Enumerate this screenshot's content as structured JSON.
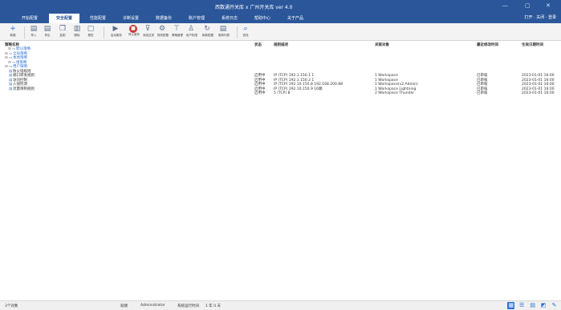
{
  "window": {
    "title": "西数通开关库 x 广州开关库 ver 4.0",
    "controls": [
      "—",
      "▢",
      "✕"
    ]
  },
  "tabs": [
    {
      "label": "开始配置",
      "active": false
    },
    {
      "label": "安全配置",
      "active": true
    },
    {
      "label": "性能配置",
      "active": false
    },
    {
      "label": "诊断设置",
      "active": false
    },
    {
      "label": "数据备份",
      "active": false
    },
    {
      "label": "账户管理",
      "active": false
    },
    {
      "label": "系统日志",
      "active": false
    },
    {
      "label": "帮助中心",
      "active": false
    },
    {
      "label": "关于产品",
      "active": false
    }
  ],
  "tabs_right": "打开 · 关闭 · 登录",
  "toolbar": [
    {
      "label": "新建",
      "icon": "plus-icon",
      "glyph": "+",
      "style": "blue"
    },
    {
      "label": "导入",
      "icon": "import-icon",
      "glyph": "▤",
      "style": ""
    },
    {
      "label": "导出",
      "icon": "export-icon",
      "glyph": "▤",
      "style": ""
    },
    {
      "label": "复制",
      "icon": "copy-icon",
      "glyph": "❐",
      "style": ""
    },
    {
      "label": "删除",
      "icon": "delete-icon",
      "glyph": "▥",
      "style": ""
    },
    {
      "label": "属性",
      "icon": "properties-icon",
      "glyph": "▢",
      "style": ""
    },
    {
      "label": "启动服务",
      "icon": "play-icon",
      "glyph": "▶",
      "style": ""
    },
    {
      "label": "停止服务",
      "icon": "stop-icon",
      "glyph": "■",
      "style": "red"
    },
    {
      "label": "添加过滤",
      "icon": "filter-icon",
      "glyph": "⊽",
      "style": ""
    },
    {
      "label": "规则配置",
      "icon": "rule-icon",
      "glyph": "⚙",
      "style": ""
    },
    {
      "label": "策略管理",
      "icon": "policy-icon",
      "glyph": "⊤",
      "style": ""
    },
    {
      "label": "用户权限",
      "icon": "user-icon",
      "glyph": "♙",
      "style": ""
    },
    {
      "label": "刷新配置",
      "icon": "refresh-icon",
      "glyph": "↻",
      "style": ""
    },
    {
      "label": "更新列表",
      "icon": "list-icon",
      "glyph": "▤",
      "style": ""
    },
    {
      "label": "查找",
      "icon": "search-icon",
      "glyph": "⌕",
      "style": "blue"
    }
  ],
  "tree": {
    "header": "策略名称",
    "nodes": [
      {
        "label": "默认策略",
        "depth": 1,
        "blue": true,
        "icon": "folder-icon"
      },
      {
        "label": "全局策略",
        "depth": 0,
        "blue": true,
        "icon": "folder-icon"
      },
      {
        "label": "本地策略",
        "depth": 0,
        "blue": true,
        "icon": "folder-icon"
      },
      {
        "label": "组策略",
        "depth": 1,
        "blue": true,
        "icon": "folder-icon"
      },
      {
        "label": "用户策略",
        "depth": 0,
        "blue": true,
        "icon": "folder-icon"
      },
      {
        "label": "防火墙规则",
        "depth": 0,
        "blue": false,
        "icon": "document-icon"
      },
      {
        "label": "端口转发规则",
        "depth": 0,
        "blue": false,
        "icon": "document-icon"
      },
      {
        "label": "访问控制",
        "depth": 0,
        "blue": false,
        "icon": "document-icon"
      },
      {
        "label": "入侵检测",
        "depth": 0,
        "blue": false,
        "icon": "document-icon"
      },
      {
        "label": "流量限制规则",
        "depth": 0,
        "blue": false,
        "icon": "document-icon"
      }
    ]
  },
  "table": {
    "headers": [
      "状态",
      "规则描述",
      "关联对象",
      "最近修改时间",
      "生效日期时间"
    ],
    "rows": [
      [
        "启用中",
        "IP (TCP) 192.1.150.1 1",
        "1 Workspace",
        "已审核",
        "2023-01-01 16:00"
      ],
      [
        "启用中",
        "IP (TCP) 192.1.150.2 1",
        "1 Workspace",
        "已审核",
        "2023-01-01 16:00"
      ],
      [
        "启用中",
        "IP (TCP) 192.10.150.8 192.168.200.88",
        "1 Workspace(v2.Admin)",
        "已审核",
        "2023-01-01 16:00"
      ],
      [
        "启用中",
        "IP (TCP) 192.10.150.9 16端",
        "1 Workspace Lightning",
        "已审核",
        "2023-01-01 16:00"
      ],
      [
        "启用中",
        "5 (TCP) 8",
        "2 Workspace Thunder",
        "已审核",
        "2023-01-01 16:00"
      ]
    ]
  },
  "statusbar": {
    "left": "3个对象",
    "mid1": "就绪",
    "mid2": "Administrator",
    "mid3": "系统运行时间",
    "mid4": "1 年 0 天"
  }
}
